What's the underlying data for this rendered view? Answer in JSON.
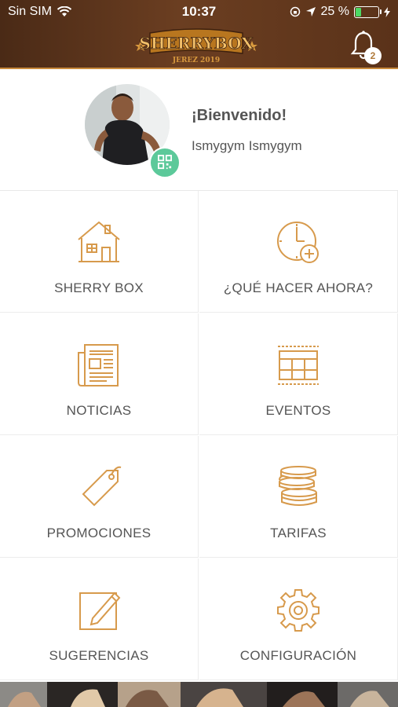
{
  "status_bar": {
    "carrier": "Sin SIM",
    "time": "10:37",
    "battery_percent": "25 %",
    "battery_level": 0.25
  },
  "header": {
    "logo_title": "SHERRYBOX",
    "logo_subtitle": "JEREZ 2019",
    "notification_count": "2"
  },
  "profile": {
    "greeting": "¡Bienvenido!",
    "username": "Ismygym Ismygym"
  },
  "menu": [
    {
      "label": "SHERRY BOX",
      "icon": "house-icon"
    },
    {
      "label": "¿QUÉ HACER AHORA?",
      "icon": "clock-plus-icon"
    },
    {
      "label": "NOTICIAS",
      "icon": "newspaper-icon"
    },
    {
      "label": "EVENTOS",
      "icon": "events-icon"
    },
    {
      "label": "PROMOCIONES",
      "icon": "tag-icon"
    },
    {
      "label": "TARIFAS",
      "icon": "coins-icon"
    },
    {
      "label": "SUGERENCIAS",
      "icon": "edit-icon"
    },
    {
      "label": "CONFIGURACIÓN",
      "icon": "gear-icon"
    }
  ],
  "colors": {
    "header_brown": "#5a3219",
    "accent_gold": "#d79a4c",
    "qr_green": "#5cc99a",
    "label_gray": "#555555"
  }
}
